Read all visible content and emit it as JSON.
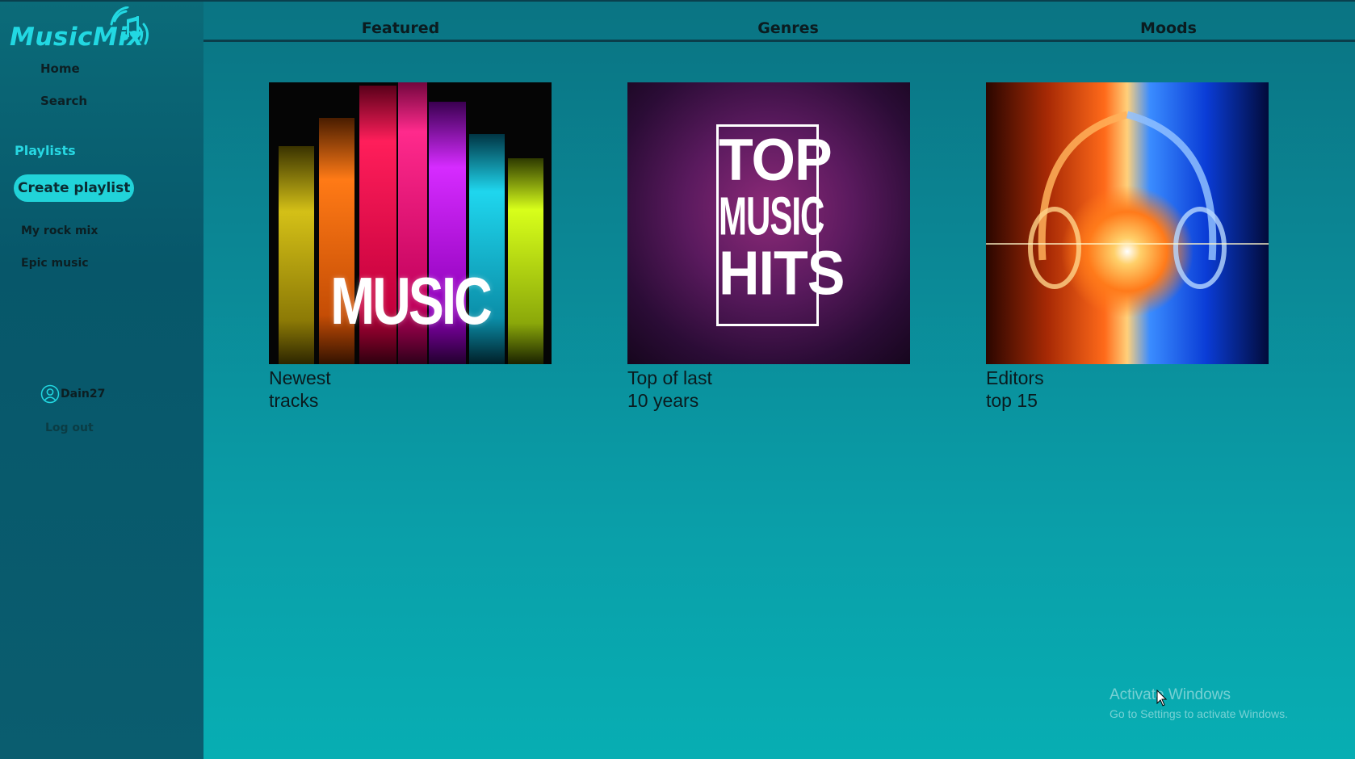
{
  "app": {
    "logo_text": "MusicMix",
    "accent_color": "#22d8e2"
  },
  "sidebar": {
    "nav": [
      {
        "label": "Home",
        "icon": "home-icon"
      },
      {
        "label": "Search",
        "icon": "search-icon"
      }
    ],
    "playlists_heading": "Playlists",
    "create_playlist_label": "Create playlist",
    "playlists": [
      {
        "label": "My rock mix"
      },
      {
        "label": "Epic music"
      }
    ],
    "user": {
      "name": "Dain27",
      "icon": "user-icon"
    },
    "logout_label": "Log out"
  },
  "tabs": [
    {
      "label": "Featured"
    },
    {
      "label": "Genres"
    },
    {
      "label": "Moods"
    }
  ],
  "cards": [
    {
      "title_line1": "Newest",
      "title_line2": "tracks",
      "cover_text": "MUSIC"
    },
    {
      "title_line1": "Top of last",
      "title_line2": "10 years",
      "cover_text": [
        "TOP",
        "MUSIC",
        "HITS"
      ]
    },
    {
      "title_line1": "Editors",
      "title_line2": "top 15",
      "cover_text": ""
    }
  ],
  "watermark": {
    "line1": "Activate Windows",
    "line2": "Go to Settings to activate Windows."
  }
}
